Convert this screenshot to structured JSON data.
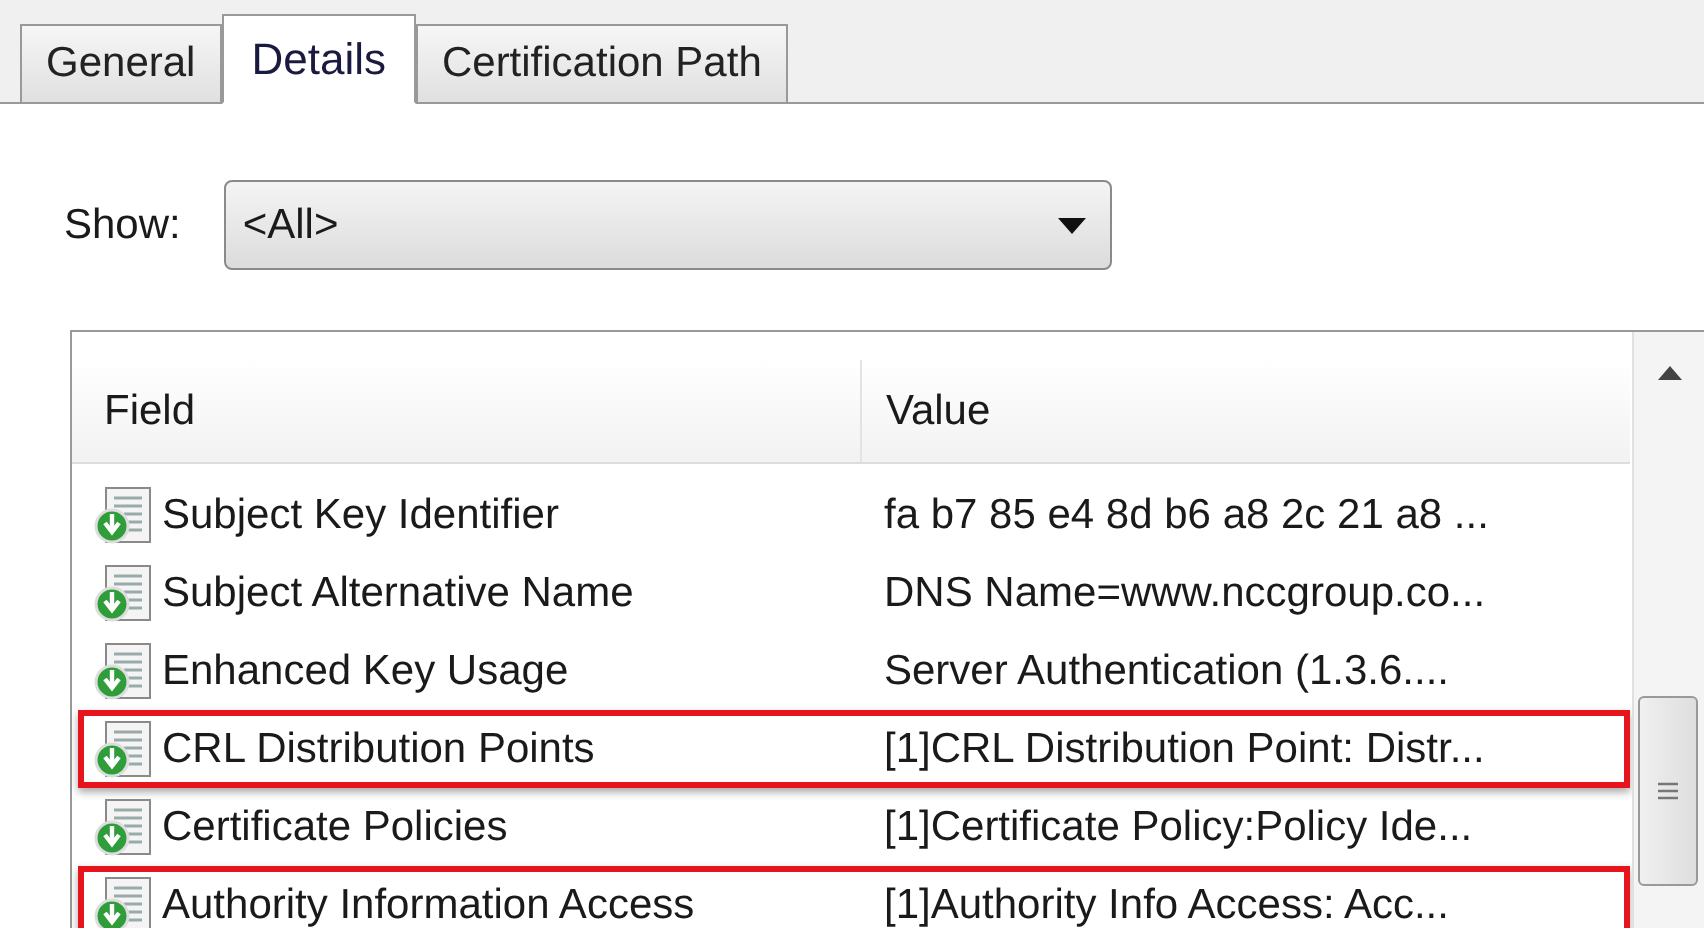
{
  "tabs": [
    {
      "label": "General",
      "selected": false
    },
    {
      "label": "Details",
      "selected": true
    },
    {
      "label": "Certification Path",
      "selected": false
    }
  ],
  "show": {
    "label": "Show:",
    "value": "<All>"
  },
  "table": {
    "columns": [
      "Field",
      "Value"
    ],
    "rows": [
      {
        "field": "Subject Key Identifier",
        "value": "fa b7 85 e4 8d b6 a8 2c 21 a8 ...",
        "highlighted": false
      },
      {
        "field": "Subject Alternative Name",
        "value": "DNS Name=www.nccgroup.co...",
        "highlighted": false
      },
      {
        "field": "Enhanced Key Usage",
        "value": "Server Authentication (1.3.6....",
        "highlighted": false
      },
      {
        "field": "CRL Distribution Points",
        "value": "[1]CRL Distribution Point: Distr...",
        "highlighted": true
      },
      {
        "field": "Certificate Policies",
        "value": "[1]Certificate Policy:Policy Ide...",
        "highlighted": false
      },
      {
        "field": "Authority Information Access",
        "value": "[1]Authority Info Access: Acc...",
        "highlighted": true
      }
    ]
  }
}
